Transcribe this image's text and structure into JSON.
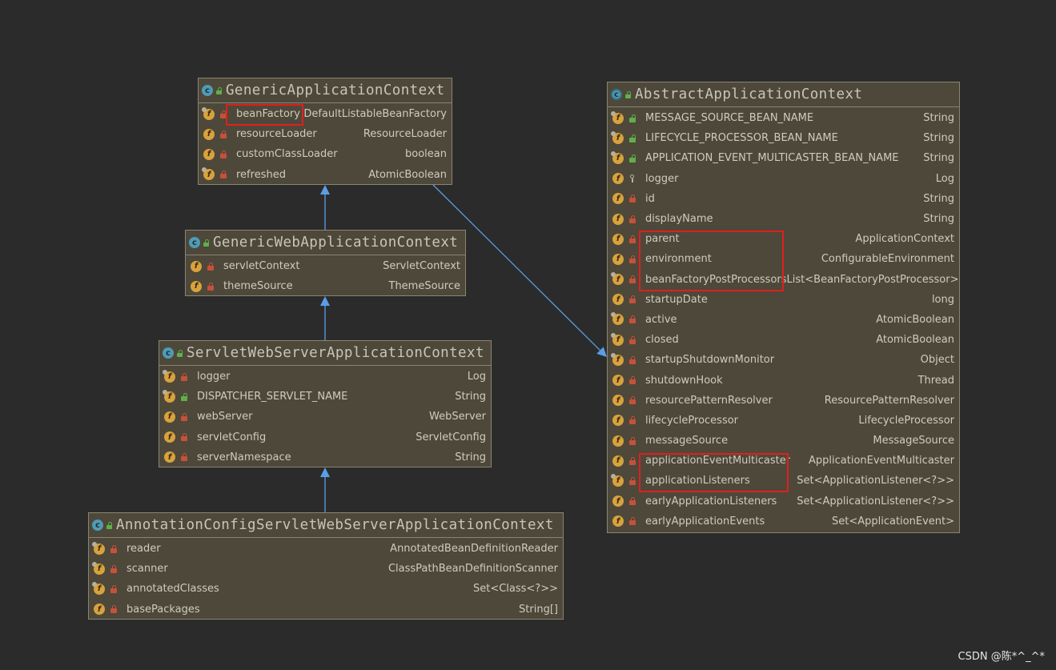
{
  "classes": {
    "generic_application_context": {
      "name": "GenericApplicationContext",
      "kind": "class",
      "fields": [
        {
          "name": "beanFactory",
          "type": "DefaultListableBeanFactory",
          "visibility": "private",
          "static": true
        },
        {
          "name": "resourceLoader",
          "type": "ResourceLoader",
          "visibility": "private",
          "static": false
        },
        {
          "name": "customClassLoader",
          "type": "boolean",
          "visibility": "private",
          "static": false
        },
        {
          "name": "refreshed",
          "type": "AtomicBoolean",
          "visibility": "private",
          "static": true
        }
      ]
    },
    "generic_web_application_context": {
      "name": "GenericWebApplicationContext",
      "kind": "class",
      "fields": [
        {
          "name": "servletContext",
          "type": "ServletContext",
          "visibility": "private",
          "static": false
        },
        {
          "name": "themeSource",
          "type": "ThemeSource",
          "visibility": "private",
          "static": false
        }
      ]
    },
    "servlet_web_server_application_context": {
      "name": "ServletWebServerApplicationContext",
      "kind": "class",
      "fields": [
        {
          "name": "logger",
          "type": "Log",
          "visibility": "private",
          "static": true
        },
        {
          "name": "DISPATCHER_SERVLET_NAME",
          "type": "String",
          "visibility": "public",
          "static": true
        },
        {
          "name": "webServer",
          "type": "WebServer",
          "visibility": "private",
          "static": false
        },
        {
          "name": "servletConfig",
          "type": "ServletConfig",
          "visibility": "private",
          "static": false
        },
        {
          "name": "serverNamespace",
          "type": "String",
          "visibility": "private",
          "static": false
        }
      ]
    },
    "annotation_config_servlet_web_server_application_context": {
      "name": "AnnotationConfigServletWebServerApplicationContext",
      "kind": "class",
      "fields": [
        {
          "name": "reader",
          "type": "AnnotatedBeanDefinitionReader",
          "visibility": "private",
          "static": true
        },
        {
          "name": "scanner",
          "type": "ClassPathBeanDefinitionScanner",
          "visibility": "private",
          "static": true
        },
        {
          "name": "annotatedClasses",
          "type": "Set<Class<?>>",
          "visibility": "private",
          "static": true
        },
        {
          "name": "basePackages",
          "type": "String[]",
          "visibility": "private",
          "static": false
        }
      ]
    },
    "abstract_application_context": {
      "name": "AbstractApplicationContext",
      "kind": "abstract",
      "fields": [
        {
          "name": "MESSAGE_SOURCE_BEAN_NAME",
          "type": "String",
          "visibility": "public",
          "static": true
        },
        {
          "name": "LIFECYCLE_PROCESSOR_BEAN_NAME",
          "type": "String",
          "visibility": "public",
          "static": true
        },
        {
          "name": "APPLICATION_EVENT_MULTICASTER_BEAN_NAME",
          "type": "String",
          "visibility": "public",
          "static": true
        },
        {
          "name": "logger",
          "type": "Log",
          "visibility": "package",
          "static": false
        },
        {
          "name": "id",
          "type": "String",
          "visibility": "private",
          "static": false
        },
        {
          "name": "displayName",
          "type": "String",
          "visibility": "private",
          "static": false
        },
        {
          "name": "parent",
          "type": "ApplicationContext",
          "visibility": "private",
          "static": false
        },
        {
          "name": "environment",
          "type": "ConfigurableEnvironment",
          "visibility": "private",
          "static": false
        },
        {
          "name": "beanFactoryPostProcessors",
          "type": "List<BeanFactoryPostProcessor>",
          "visibility": "private",
          "static": true
        },
        {
          "name": "startupDate",
          "type": "long",
          "visibility": "private",
          "static": false
        },
        {
          "name": "active",
          "type": "AtomicBoolean",
          "visibility": "private",
          "static": true
        },
        {
          "name": "closed",
          "type": "AtomicBoolean",
          "visibility": "private",
          "static": true
        },
        {
          "name": "startupShutdownMonitor",
          "type": "Object",
          "visibility": "private",
          "static": true
        },
        {
          "name": "shutdownHook",
          "type": "Thread",
          "visibility": "private",
          "static": false
        },
        {
          "name": "resourcePatternResolver",
          "type": "ResourcePatternResolver",
          "visibility": "private",
          "static": false
        },
        {
          "name": "lifecycleProcessor",
          "type": "LifecycleProcessor",
          "visibility": "private",
          "static": false
        },
        {
          "name": "messageSource",
          "type": "MessageSource",
          "visibility": "private",
          "static": false
        },
        {
          "name": "applicationEventMulticaster",
          "type": "ApplicationEventMulticaster",
          "visibility": "private",
          "static": false
        },
        {
          "name": "applicationListeners",
          "type": "Set<ApplicationListener<?>>",
          "visibility": "private",
          "static": true
        },
        {
          "name": "earlyApplicationListeners",
          "type": "Set<ApplicationListener<?>>",
          "visibility": "private",
          "static": false
        },
        {
          "name": "earlyApplicationEvents",
          "type": "Set<ApplicationEvent>",
          "visibility": "private",
          "static": false
        }
      ]
    }
  },
  "relations": [
    {
      "from": "generic_web_application_context",
      "to": "generic_application_context",
      "type": "extends"
    },
    {
      "from": "servlet_web_server_application_context",
      "to": "generic_web_application_context",
      "type": "extends"
    },
    {
      "from": "annotation_config_servlet_web_server_application_context",
      "to": "servlet_web_server_application_context",
      "type": "extends"
    },
    {
      "from": "generic_application_context",
      "to": "abstract_application_context",
      "type": "extends"
    }
  ],
  "highlights": [
    {
      "class": "generic_application_context",
      "fields": [
        "beanFactory"
      ]
    },
    {
      "class": "abstract_application_context",
      "fields": [
        "parent",
        "environment",
        "beanFactoryPostProcessors"
      ]
    },
    {
      "class": "abstract_application_context",
      "fields": [
        "applicationEventMulticaster",
        "applicationListeners"
      ]
    }
  ],
  "colors": {
    "background": "#2b2b2b",
    "class_fill": "#4d483a",
    "class_border": "#8a8571",
    "arrow": "#5a9ee6",
    "highlight": "#e01f1f"
  },
  "watermark": "CSDN @陈*^_^*"
}
